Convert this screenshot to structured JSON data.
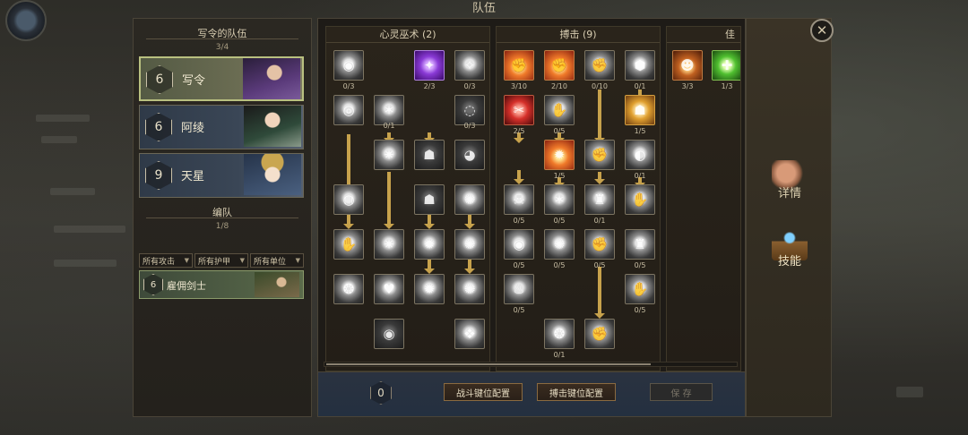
{
  "window_title": "队伍",
  "party": {
    "title": "写令的队伍",
    "count": "3/4",
    "members": [
      {
        "level": "6",
        "name": "写令",
        "selected": true
      },
      {
        "level": "6",
        "name": "阿绫",
        "selected": false
      },
      {
        "level": "9",
        "name": "天星",
        "selected": false
      }
    ]
  },
  "formation": {
    "title": "编队",
    "count": "1/8",
    "filters": [
      "所有攻击",
      "所有护甲",
      "所有单位"
    ],
    "units": [
      {
        "level": "6",
        "name": "雇佣剑士"
      }
    ]
  },
  "trees": [
    {
      "title": "心灵巫术 (2)",
      "skills": [
        {
          "style": "gray",
          "glyph": "◉",
          "level": "0/3"
        },
        {
          "style": "purple",
          "glyph": "✦",
          "level": "2/3"
        },
        {
          "style": "gray",
          "glyph": "✧",
          "level": "0/3"
        },
        {
          "style": "gray",
          "glyph": "◎",
          "level": ""
        },
        {
          "style": "gray",
          "glyph": "✶",
          "level": "0/1"
        },
        {
          "style": "dark",
          "glyph": "◌",
          "level": "0/3"
        },
        {
          "style": "gray",
          "glyph": "✷",
          "level": ""
        },
        {
          "style": "dark",
          "glyph": "☗",
          "level": ""
        },
        {
          "style": "dark",
          "glyph": "◕",
          "level": ""
        },
        {
          "style": "gray",
          "glyph": "◍",
          "level": ""
        },
        {
          "style": "dark",
          "glyph": "☗",
          "level": ""
        },
        {
          "style": "gray",
          "glyph": "✺",
          "level": ""
        },
        {
          "style": "gray",
          "glyph": "✋",
          "level": ""
        },
        {
          "style": "gray",
          "glyph": "✷",
          "level": ""
        },
        {
          "style": "gray",
          "glyph": "✹",
          "level": ""
        },
        {
          "style": "gray",
          "glyph": "✺",
          "level": ""
        },
        {
          "style": "gray",
          "glyph": "❂",
          "level": ""
        },
        {
          "style": "gray",
          "glyph": "♥",
          "level": ""
        },
        {
          "style": "gray",
          "glyph": "✹",
          "level": ""
        },
        {
          "style": "gray",
          "glyph": "✺",
          "level": ""
        },
        {
          "style": "dark",
          "glyph": "◉",
          "level": ""
        },
        {
          "style": "gray",
          "glyph": "❖",
          "level": ""
        }
      ]
    },
    {
      "title": "搏击 (9)",
      "skills": [
        {
          "style": "fire",
          "glyph": "✊",
          "level": "3/10"
        },
        {
          "style": "fire",
          "glyph": "✊",
          "level": "2/10"
        },
        {
          "style": "gray",
          "glyph": "✊",
          "level": "0/10"
        },
        {
          "style": "gray",
          "glyph": "⬢",
          "level": "0/1"
        },
        {
          "style": "red",
          "glyph": "✂",
          "level": "2/5"
        },
        {
          "style": "gray",
          "glyph": "✋",
          "level": "0/5"
        },
        {
          "style": "gold",
          "glyph": "☗",
          "level": "1/5"
        },
        {
          "style": "fire",
          "glyph": "✹",
          "level": "1/5"
        },
        {
          "style": "gray",
          "glyph": "✊",
          "level": ""
        },
        {
          "style": "gray",
          "glyph": "◐",
          "level": "0/1"
        },
        {
          "style": "gray",
          "glyph": "☠",
          "level": "0/5"
        },
        {
          "style": "gray",
          "glyph": "✶",
          "level": "0/5"
        },
        {
          "style": "gray",
          "glyph": "♜",
          "level": "0/1"
        },
        {
          "style": "gray",
          "glyph": "✋",
          "level": ""
        },
        {
          "style": "gray",
          "glyph": "◉",
          "level": "0/5"
        },
        {
          "style": "gray",
          "glyph": "✺",
          "level": "0/5"
        },
        {
          "style": "gray",
          "glyph": "✊",
          "level": "0/5"
        },
        {
          "style": "gray",
          "glyph": "♜",
          "level": "0/5"
        },
        {
          "style": "gray",
          "glyph": "♨",
          "level": "0/5"
        },
        {
          "style": "gray",
          "glyph": "✋",
          "level": "0/5"
        },
        {
          "style": "gray",
          "glyph": "❂",
          "level": "0/1"
        },
        {
          "style": "gray",
          "glyph": "✊",
          "level": ""
        }
      ]
    },
    {
      "title": "佳",
      "skills": [
        {
          "style": "orange",
          "glyph": "☻",
          "level": "3/3"
        },
        {
          "style": "green",
          "glyph": "✚",
          "level": "1/3"
        }
      ]
    }
  ],
  "skill_points": "0",
  "buttons": {
    "combat_keys": "战斗键位配置",
    "melee_keys": "搏击键位配置",
    "save": "保 存"
  },
  "tabs": {
    "details": "详情",
    "skills": "技能"
  },
  "close_icon": "✕"
}
